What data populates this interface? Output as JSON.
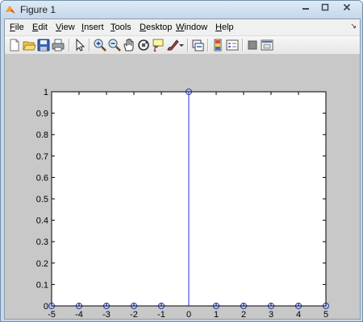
{
  "window": {
    "title": "Figure 1",
    "minimize_icon": "minimize-icon",
    "maximize_icon": "maximize-icon",
    "close_icon": "close-icon"
  },
  "menubar": {
    "items": [
      {
        "mnemonic": "F",
        "rest": "ile"
      },
      {
        "mnemonic": "E",
        "rest": "dit"
      },
      {
        "mnemonic": "V",
        "rest": "iew"
      },
      {
        "mnemonic": "I",
        "rest": "nsert"
      },
      {
        "mnemonic": "T",
        "rest": "ools"
      },
      {
        "mnemonic": "D",
        "rest": "esktop"
      },
      {
        "mnemonic": "W",
        "rest": "indow"
      },
      {
        "mnemonic": "H",
        "rest": "elp"
      }
    ],
    "dock_arrow": "↘"
  },
  "toolbar": {
    "icons": [
      "new-figure-icon",
      "open-file-icon",
      "save-icon",
      "print-icon",
      "edit-plot-pointer-icon",
      "zoom-in-icon",
      "zoom-out-icon",
      "pan-hand-icon",
      "rotate-3d-icon",
      "data-cursor-icon",
      "brush-icon",
      "brush-dropdown-icon",
      "link-plot-icon",
      "insert-colorbar-icon",
      "insert-legend-icon",
      "hide-plot-tools-icon",
      "show-plot-tools-icon"
    ]
  },
  "colors": {
    "stem": "#1f3ad0",
    "axes_bg": "#ffffff",
    "figure_bg": "#c8c8c8"
  },
  "chart_data": {
    "type": "scatter",
    "style": "stem",
    "marker": "open-circle",
    "x": [
      -5,
      -4,
      -3,
      -2,
      -1,
      0,
      1,
      2,
      3,
      4,
      5
    ],
    "y": [
      0,
      0,
      0,
      0,
      0,
      1,
      0,
      0,
      0,
      0,
      0
    ],
    "xlim": [
      -5,
      5
    ],
    "ylim": [
      0,
      1
    ],
    "xticks": [
      "-5",
      "-4",
      "-3",
      "-2",
      "-1",
      "0",
      "1",
      "2",
      "3",
      "4",
      "5"
    ],
    "yticks": [
      "0",
      "0.1",
      "0.2",
      "0.3",
      "0.4",
      "0.5",
      "0.6",
      "0.7",
      "0.8",
      "0.9",
      "1"
    ],
    "title": "",
    "xlabel": "",
    "ylabel": "",
    "grid": false
  }
}
